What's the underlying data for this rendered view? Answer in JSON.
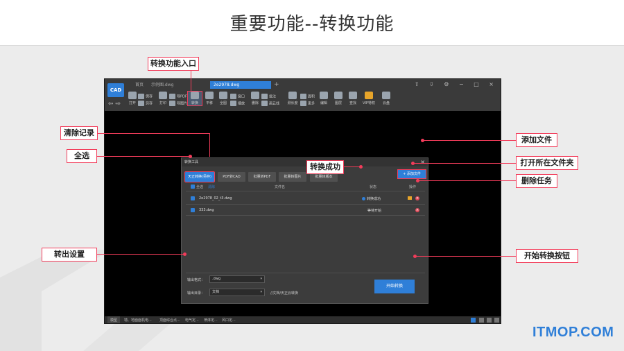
{
  "slide": {
    "title": "重要功能--转换功能"
  },
  "app": {
    "tabs": {
      "home": "首页",
      "sample": "示例图.dwg",
      "active": "2e2978.dwg",
      "add": "+"
    },
    "window_controls": "⇧ ⇩ ⚙ − □ ×",
    "logo": "CAD",
    "undo_redo": "⇦ ⇨",
    "tools": {
      "open": "打开",
      "save": "保存",
      "save_as": "另存",
      "print": "打印",
      "export_pdf": "导PDF",
      "export_img": "导图片",
      "convert": "转换",
      "pan": "平移",
      "full": "全图",
      "window": "窗口",
      "zoom": "缩放",
      "delete": "删除",
      "annotate": "批注",
      "draw_cloud": "画云线",
      "measure_len": "测长度",
      "area": "面积",
      "more": "更多",
      "edit": "编辑",
      "layer": "图层",
      "find": "查找",
      "vip": "VIP特权",
      "cloud": "云盘"
    },
    "statusbar": [
      "模型",
      "墙、地面面机电...",
      "顶面综合点...",
      "电气定...",
      "喷淋定...",
      "风口定..."
    ]
  },
  "dialog": {
    "title": "转换工具",
    "close": "×",
    "tabs": [
      "天正转换(另存)",
      "PDF转CAD",
      "批量转PDF",
      "批量转图片",
      "批量转版本"
    ],
    "add_file": "+ 添加文件",
    "header": {
      "select_all": "全选",
      "clear": "清除",
      "filename": "文件名",
      "status": "状态",
      "action": "操作"
    },
    "rows": [
      {
        "name": "2e2978_02_t3.dwg",
        "status": "转换成功"
      },
      {
        "name": "333.dwg",
        "status": "等待开始"
      }
    ],
    "output_format_label": "输出格式：",
    "output_format_value": ".dwg",
    "output_dir_label": "输出目录：",
    "output_dir_value": "文档",
    "output_dir_path": "//文档/天正云转换",
    "start_button": "开始转换"
  },
  "callouts": {
    "entry": "转换功能入口",
    "clear_records": "清除记录",
    "select_all": "全选",
    "convert_success": "转换成功",
    "output_settings": "转出设置",
    "add_file": "添加文件",
    "open_folder": "打开所在文件夹",
    "delete_task": "删除任务",
    "start_button": "开始转换按钮"
  },
  "watermark": "ITMOP.COM"
}
